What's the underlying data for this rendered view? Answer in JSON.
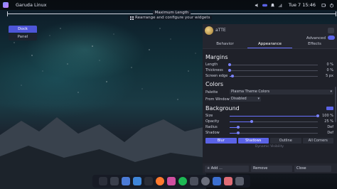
{
  "top_panel": {
    "title": "Garuda Linux",
    "clock": "Tue 7 15:46"
  },
  "ruler": {
    "label": "Maximum Length",
    "caption": "Rearrange and configure your widgets"
  },
  "mode_toggle": {
    "dock_label": "Dock",
    "panel_label": "Panel"
  },
  "settings": {
    "header_name": "aTTE",
    "advanced_label": "Advanced",
    "tabs": [
      "Behavior",
      "Appearance",
      "Effects"
    ],
    "active_tab": "Appearance",
    "margins": {
      "heading": "Margins",
      "rows": [
        {
          "label": "Length",
          "value": "0 %",
          "level": 0
        },
        {
          "label": "Thickness",
          "value": "0 %",
          "level": 0
        },
        {
          "label": "Screen edge",
          "value": "5 px",
          "level": 0.03
        }
      ]
    },
    "colors": {
      "heading": "Colors",
      "palette_label": "Palette",
      "palette_value": "Plasma Theme Colors",
      "from_window_label": "From Window",
      "from_window_value": "Disabled"
    },
    "background": {
      "heading": "Background",
      "swatch_color": "#5b63e6",
      "rows": [
        {
          "label": "Size",
          "value": "100 %",
          "level": 1.0
        },
        {
          "label": "Opacity",
          "value": "25 %",
          "level": 0.25
        },
        {
          "label": "Radius",
          "value": "Def",
          "level": 0.1
        },
        {
          "label": "Shadow",
          "value": "Def",
          "level": 0.1
        }
      ],
      "segments": [
        "Blur",
        "Shadows",
        "Outline",
        "All Corners"
      ],
      "active_segments": [
        "Blur",
        "Shadows"
      ],
      "dynamic_label": "Dynamic Visibility"
    },
    "bottom": {
      "add_label": "+ Add ...",
      "remove_label": "Remove",
      "close_label": "Close"
    }
  },
  "dock": {
    "icons": [
      "garuda-icon",
      "grid-icon",
      "files-icon",
      "folder-icon",
      "terminal-icon",
      "firefox-icon",
      "chat-icon",
      "spotify-icon",
      "settings-icon",
      "disk-icon",
      "media-icon",
      "photos-icon",
      "trash-icon"
    ]
  },
  "colors": {
    "accent": "#5b63e6",
    "window_bg": "#1f2129"
  }
}
